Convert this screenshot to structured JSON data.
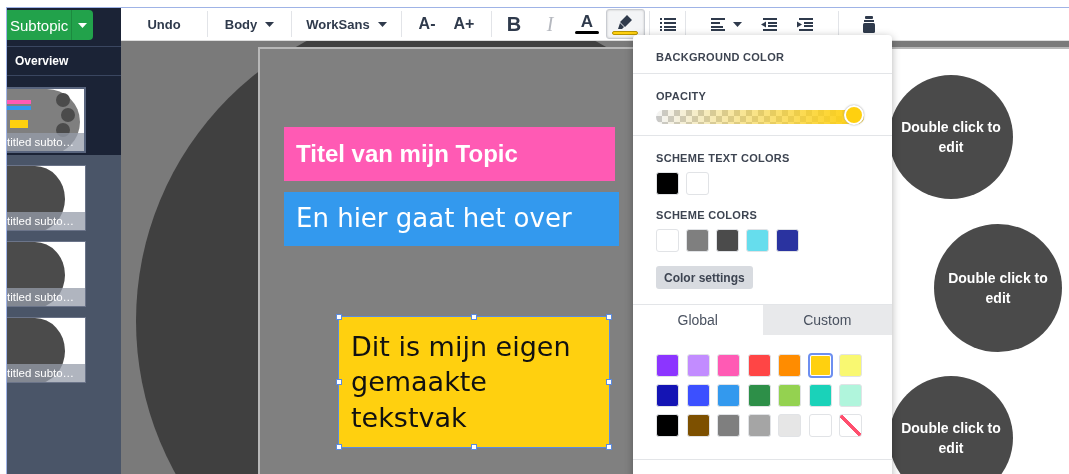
{
  "sidebar": {
    "topic_button": "Subtopic",
    "overview": "Overview",
    "thumbnails": [
      {
        "caption": "titled subto…",
        "selected": true,
        "kind": "content"
      },
      {
        "caption": "titled subto…",
        "selected": false,
        "kind": "empty"
      },
      {
        "caption": "titled subto…",
        "selected": false,
        "kind": "empty"
      },
      {
        "caption": "titled subto…",
        "selected": false,
        "kind": "empty"
      }
    ]
  },
  "toolbar": {
    "groups": [
      [
        {
          "kind": "button",
          "label": "Undo",
          "active": false,
          "disabled": false
        }
      ],
      [
        {
          "kind": "dropdown",
          "label": "Body",
          "active": false,
          "disabled": false
        }
      ],
      [
        {
          "kind": "dropdown",
          "label": "WorkSans",
          "active": false,
          "disabled": false
        }
      ],
      [
        {
          "kind": "font-smaller",
          "label": "A-",
          "active": false,
          "disabled": false
        },
        {
          "kind": "font-larger",
          "label": "A+",
          "active": false,
          "disabled": false
        }
      ],
      [
        {
          "kind": "bold",
          "label": "B",
          "active": false,
          "disabled": false
        },
        {
          "kind": "italic",
          "label": "I",
          "active": false,
          "disabled": true
        },
        {
          "kind": "text-color",
          "label": "A",
          "active": false,
          "disabled": false
        },
        {
          "kind": "highlight",
          "active": true,
          "disabled": false
        }
      ],
      [
        {
          "kind": "list",
          "active": false,
          "disabled": false
        }
      ],
      [
        {
          "kind": "align",
          "active": false,
          "disabled": false
        },
        {
          "kind": "outdent",
          "active": false,
          "disabled": false
        },
        {
          "kind": "indent",
          "active": false,
          "disabled": false
        }
      ],
      [
        {
          "kind": "clear",
          "active": false,
          "disabled": false
        }
      ]
    ]
  },
  "slide": {
    "text_boxes": [
      {
        "text": "Titel van mijn Topic",
        "color": "#ff5ab4",
        "selected": false
      },
      {
        "text": "En hier gaat het over",
        "color": "#3399ee",
        "selected": false
      },
      {
        "text": "Dit is mijn eigen gemaakte tekstvak",
        "color": "#ffd00f",
        "selected": true
      }
    ],
    "placeholders": [
      {
        "text": "Double click to edit"
      },
      {
        "text": "Double click to edit"
      },
      {
        "text": "Double click to edit"
      }
    ]
  },
  "popup": {
    "title": "BACKGROUND COLOR",
    "opacity": {
      "label": "OPACITY",
      "level": 1
    },
    "scheme_text_colors": {
      "label": "SCHEME TEXT COLORS",
      "swatches": [
        {
          "color": "#000000"
        },
        {
          "color": "#ffffff"
        }
      ]
    },
    "scheme_colors": {
      "label": "SCHEME COLORS",
      "swatches": [
        {
          "color": "#ffffff"
        },
        {
          "color": "#7f7f7f"
        },
        {
          "color": "#4b4b4b"
        },
        {
          "color": "#66dded"
        },
        {
          "color": "#2a33a0"
        }
      ]
    },
    "color_settings_button": "Color settings",
    "tabs": [
      {
        "label": "Global",
        "selected": true
      },
      {
        "label": "Custom",
        "selected": false
      }
    ],
    "palette": [
      {
        "kind": "color",
        "color": "#8c35ff",
        "selected": false
      },
      {
        "kind": "color",
        "color": "#c28cff",
        "selected": false
      },
      {
        "kind": "color",
        "color": "#ff5ab4",
        "selected": false
      },
      {
        "kind": "color",
        "color": "#ff4545",
        "selected": false
      },
      {
        "kind": "color",
        "color": "#ff8c00",
        "selected": false
      },
      {
        "kind": "color",
        "color": "#ffd00f",
        "selected": true
      },
      {
        "kind": "color",
        "color": "#f9f871",
        "selected": false
      },
      {
        "kind": "color",
        "color": "#1414b4",
        "selected": false
      },
      {
        "kind": "color",
        "color": "#3c50ff",
        "selected": false
      },
      {
        "kind": "color",
        "color": "#3399ee",
        "selected": false
      },
      {
        "kind": "color",
        "color": "#2d8f48",
        "selected": false
      },
      {
        "kind": "color",
        "color": "#94d250",
        "selected": false
      },
      {
        "kind": "color",
        "color": "#1ad2b9",
        "selected": false
      },
      {
        "kind": "color",
        "color": "#b0f5dc",
        "selected": false
      },
      {
        "kind": "color",
        "color": "#000000",
        "selected": false
      },
      {
        "kind": "color",
        "color": "#7d5000",
        "selected": false
      },
      {
        "kind": "color",
        "color": "#7f7f7f",
        "selected": false
      },
      {
        "kind": "color",
        "color": "#a5a5a5",
        "selected": false
      },
      {
        "kind": "color",
        "color": "#e6e6e6",
        "selected": false
      },
      {
        "kind": "color",
        "color": "#ffffff",
        "selected": false
      },
      {
        "kind": "none",
        "selected": false
      }
    ]
  }
}
